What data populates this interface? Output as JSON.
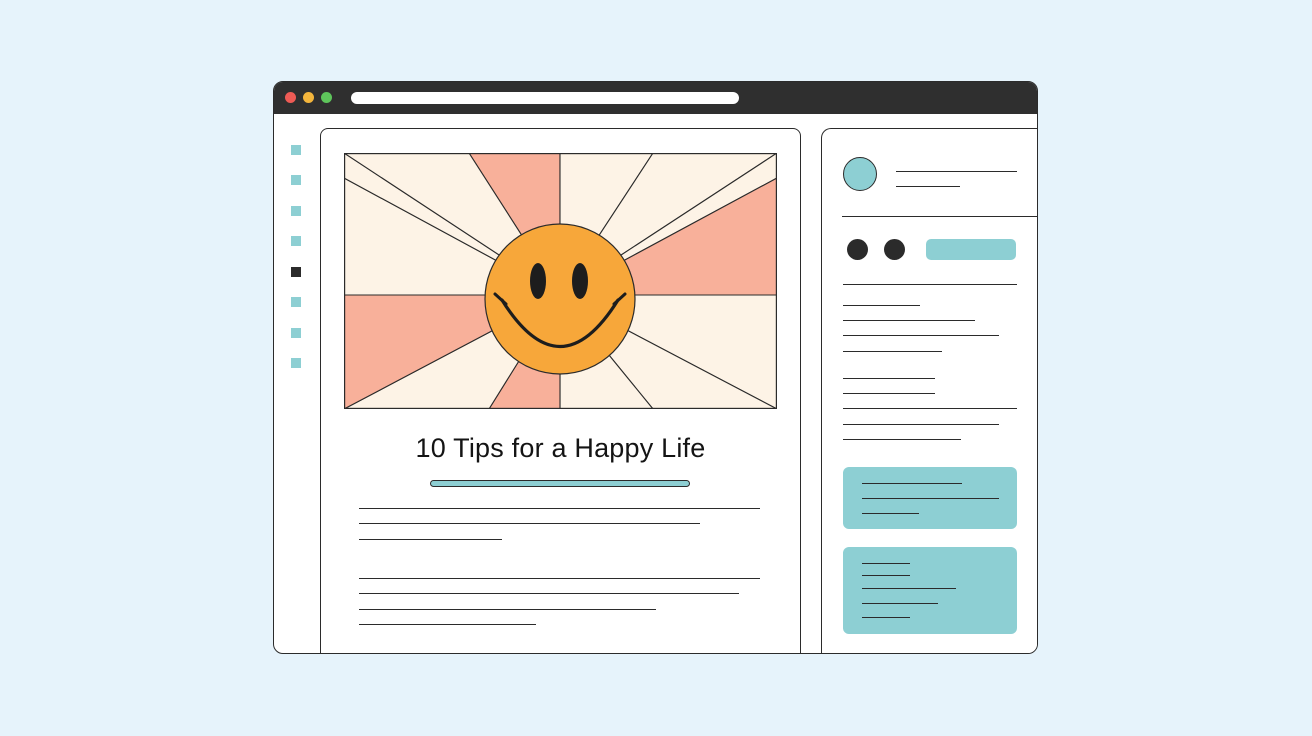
{
  "article": {
    "title": "10 Tips for a Happy Life"
  },
  "hero": {
    "icon": "smiley-face-icon",
    "colors": {
      "sun": "#f7a73a",
      "ray_light": "#fdf3e6",
      "ray_accent": "#f8b09a",
      "outline": "#2b2b2b"
    }
  },
  "colors": {
    "background": "#e6f3fb",
    "titlebar": "#2f2f2f",
    "accent_teal": "#8dcfd3",
    "close": "#ee5b55",
    "minimize": "#f3b53c",
    "maximize": "#5ec55b",
    "active_nav": "#2b2b2b"
  },
  "window_controls": [
    "close-button",
    "minimize-button",
    "maximize-button"
  ],
  "leftnav": {
    "item_count": 8,
    "active_index": 4
  }
}
